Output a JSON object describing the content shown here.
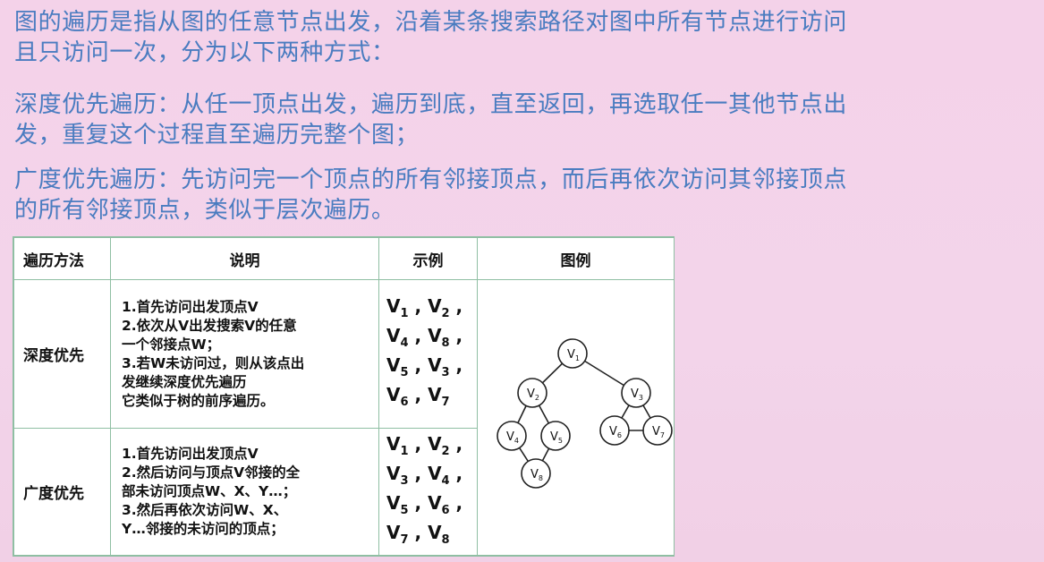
{
  "paragraphs": {
    "intro_line1": "图的遍历是指从图的任意节点出发，沿着某条搜索路径对图中所有节点进行访问",
    "intro_line2": "且只访问一次，分为以下两种方式：",
    "dfs_line1": "深度优先遍历：从任一顶点出发，遍历到底，直至返回，再选取任一其他节点出",
    "dfs_line2": "发，重复这个过程直至遍历完整个图；",
    "bfs_line1": "广度优先遍历：先访问完一个顶点的所有邻接顶点，而后再依次访问其邻接顶点",
    "bfs_line2": "的所有邻接顶点，类似于层次遍历。"
  },
  "table": {
    "headers": {
      "method": "遍历方法",
      "description": "说明",
      "example": "示例",
      "figure": "图例"
    },
    "rows": [
      {
        "method": "深度优先",
        "description_lines": [
          "1.首先访问出发顶点V",
          "2.依次从V出发搜索V的任意",
          "一个邻接点W；",
          "3.若W未访问过，则从该点出",
          "发继续深度优先遍历",
          "它类似于树的前序遍历。"
        ],
        "example_order": [
          "1",
          "2",
          "4",
          "8",
          "5",
          "3",
          "6",
          "7"
        ]
      },
      {
        "method": "广度优先",
        "description_lines": [
          "1.首先访问出发顶点V",
          "2.然后访问与顶点V邻接的全",
          "部未访问顶点W、X、Y…；",
          "3.然后再依次访问W、X、",
          "Y…邻接的未访问的顶点；"
        ],
        "example_order": [
          "1",
          "2",
          "3",
          "4",
          "5",
          "6",
          "7",
          "8"
        ]
      }
    ]
  },
  "graph": {
    "vertex_letter": "V",
    "nodes": [
      "1",
      "2",
      "3",
      "4",
      "5",
      "6",
      "7",
      "8"
    ],
    "edges": [
      [
        "1",
        "2"
      ],
      [
        "1",
        "3"
      ],
      [
        "2",
        "4"
      ],
      [
        "2",
        "5"
      ],
      [
        "4",
        "8"
      ],
      [
        "5",
        "8"
      ],
      [
        "3",
        "6"
      ],
      [
        "3",
        "7"
      ],
      [
        "6",
        "7"
      ]
    ]
  },
  "colors": {
    "paragraph_text": "#4a7cc0",
    "table_border": "#8fbfa3",
    "background": "#f3d4ea"
  }
}
